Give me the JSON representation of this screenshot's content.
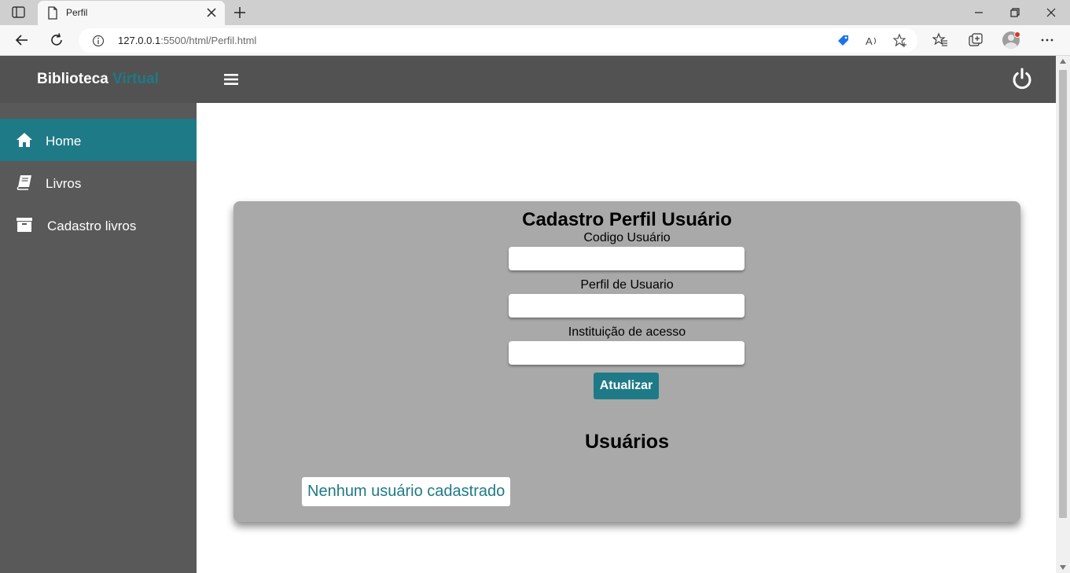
{
  "browser": {
    "tab_title": "Perfil",
    "url_host": "127.0.0.1",
    "url_path": ":5500/html/Perfil.html"
  },
  "app": {
    "brand_main": "Biblioteca",
    "brand_accent": "Virtual",
    "colors": {
      "accent": "#1e7a86",
      "topnav": "#525252",
      "sidebar": "#595959",
      "card": "#a9a9a9"
    }
  },
  "sidebar": {
    "items": [
      {
        "label": "Home",
        "icon": "home-icon",
        "active": true
      },
      {
        "label": "Livros",
        "icon": "book-icon",
        "active": false
      },
      {
        "label": "Cadastro livros",
        "icon": "archive-icon",
        "active": false
      }
    ]
  },
  "form": {
    "title": "Cadastro Perfil Usuário",
    "fields": [
      {
        "label": "Codigo Usuário",
        "value": ""
      },
      {
        "label": "Perfil de Usuario",
        "value": ""
      },
      {
        "label": "Instituição de acesso",
        "value": ""
      }
    ],
    "submit_label": "Atualizar"
  },
  "users": {
    "title": "Usuários",
    "empty_message": "Nenhum usuário cadastrado"
  }
}
